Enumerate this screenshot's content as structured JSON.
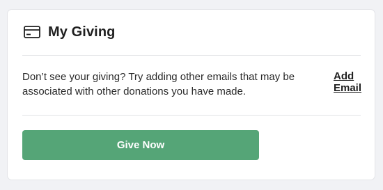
{
  "card": {
    "icon": "credit-card-icon",
    "title": "My Giving",
    "note": "Don’t see your giving? Try adding other emails that may be associated with other donations you have made.",
    "add_email_label": "Add Email",
    "give_button_label": "Give Now"
  },
  "colors": {
    "primary_button": "#55a577",
    "page_background": "#f1f2f5",
    "card_background": "#ffffff"
  }
}
